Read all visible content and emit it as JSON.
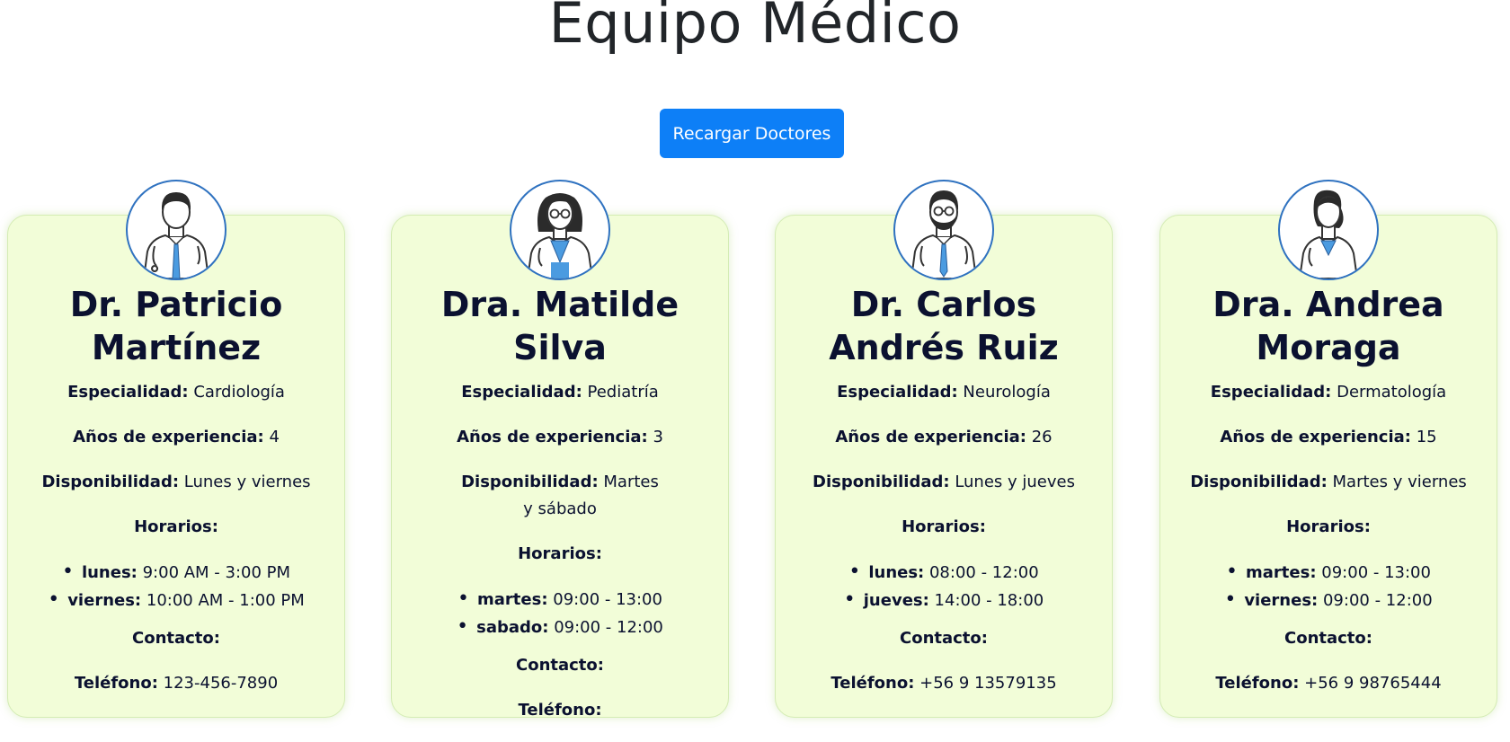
{
  "page": {
    "title": "Equipo Médico",
    "reload_button": "Recargar Doctores"
  },
  "labels": {
    "specialty": "Especialidad:",
    "experience": "Años de experiencia:",
    "availability": "Disponibilidad:",
    "schedule": "Horarios:",
    "contact": "Contacto:",
    "phone": "Teléfono:"
  },
  "colors": {
    "accent": "#0d7ff7",
    "card_background": "#f2fdd8",
    "avatar_border": "#2f72c0",
    "tie_blue": "#4b9be0"
  },
  "doctors": [
    {
      "name": "Dr. Patricio Martínez",
      "icon": "doctor-male-icon",
      "specialty": "Cardiología",
      "experience": "4",
      "availability": "Lunes y viernes",
      "schedule": [
        {
          "day": "lunes:",
          "hours": "9:00 AM - 3:00 PM"
        },
        {
          "day": "viernes:",
          "hours": "10:00 AM - 1:00 PM"
        }
      ],
      "phone": "123-456-7890"
    },
    {
      "name": "Dra. Matilde Silva",
      "icon": "doctor-female-glasses-icon",
      "specialty": "Pediatría",
      "experience": "3",
      "availability": "Martes y sábado",
      "schedule": [
        {
          "day": "martes:",
          "hours": "09:00 - 13:00"
        },
        {
          "day": "sabado:",
          "hours": "09:00 - 12:00"
        }
      ],
      "phone": ""
    },
    {
      "name": "Dr. Carlos Andrés Ruiz",
      "icon": "doctor-male-beard-icon",
      "specialty": "Neurología",
      "experience": "26",
      "availability": "Lunes y jueves",
      "schedule": [
        {
          "day": "lunes:",
          "hours": "08:00 - 12:00"
        },
        {
          "day": "jueves:",
          "hours": "14:00 - 18:00"
        }
      ],
      "phone": "+56 9 13579135"
    },
    {
      "name": "Dra. Andrea Moraga",
      "icon": "doctor-female-icon",
      "specialty": "Dermatología",
      "experience": "15",
      "availability": "Martes y viernes",
      "schedule": [
        {
          "day": "martes:",
          "hours": "09:00 - 13:00"
        },
        {
          "day": "viernes:",
          "hours": "09:00 - 12:00"
        }
      ],
      "phone": "+56 9 98765444"
    }
  ]
}
